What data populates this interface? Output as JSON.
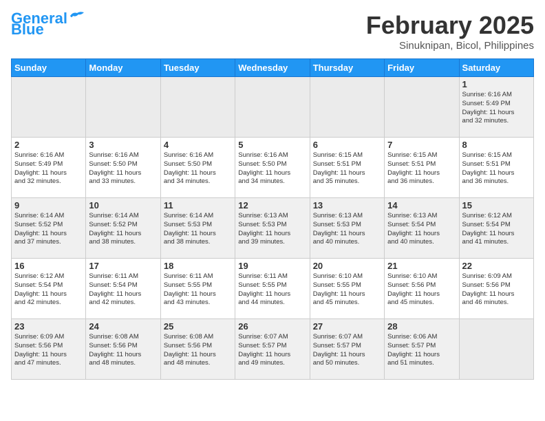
{
  "header": {
    "logo_line1": "General",
    "logo_line2": "Blue",
    "month": "February 2025",
    "location": "Sinuknipan, Bicol, Philippines"
  },
  "days_of_week": [
    "Sunday",
    "Monday",
    "Tuesday",
    "Wednesday",
    "Thursday",
    "Friday",
    "Saturday"
  ],
  "weeks": [
    [
      {
        "day": "",
        "info": ""
      },
      {
        "day": "",
        "info": ""
      },
      {
        "day": "",
        "info": ""
      },
      {
        "day": "",
        "info": ""
      },
      {
        "day": "",
        "info": ""
      },
      {
        "day": "",
        "info": ""
      },
      {
        "day": "1",
        "info": "Sunrise: 6:16 AM\nSunset: 5:49 PM\nDaylight: 11 hours\nand 32 minutes."
      }
    ],
    [
      {
        "day": "2",
        "info": "Sunrise: 6:16 AM\nSunset: 5:49 PM\nDaylight: 11 hours\nand 32 minutes."
      },
      {
        "day": "3",
        "info": "Sunrise: 6:16 AM\nSunset: 5:50 PM\nDaylight: 11 hours\nand 33 minutes."
      },
      {
        "day": "4",
        "info": "Sunrise: 6:16 AM\nSunset: 5:50 PM\nDaylight: 11 hours\nand 34 minutes."
      },
      {
        "day": "5",
        "info": "Sunrise: 6:16 AM\nSunset: 5:50 PM\nDaylight: 11 hours\nand 34 minutes."
      },
      {
        "day": "6",
        "info": "Sunrise: 6:15 AM\nSunset: 5:51 PM\nDaylight: 11 hours\nand 35 minutes."
      },
      {
        "day": "7",
        "info": "Sunrise: 6:15 AM\nSunset: 5:51 PM\nDaylight: 11 hours\nand 36 minutes."
      },
      {
        "day": "8",
        "info": "Sunrise: 6:15 AM\nSunset: 5:51 PM\nDaylight: 11 hours\nand 36 minutes."
      }
    ],
    [
      {
        "day": "9",
        "info": "Sunrise: 6:14 AM\nSunset: 5:52 PM\nDaylight: 11 hours\nand 37 minutes."
      },
      {
        "day": "10",
        "info": "Sunrise: 6:14 AM\nSunset: 5:52 PM\nDaylight: 11 hours\nand 38 minutes."
      },
      {
        "day": "11",
        "info": "Sunrise: 6:14 AM\nSunset: 5:53 PM\nDaylight: 11 hours\nand 38 minutes."
      },
      {
        "day": "12",
        "info": "Sunrise: 6:13 AM\nSunset: 5:53 PM\nDaylight: 11 hours\nand 39 minutes."
      },
      {
        "day": "13",
        "info": "Sunrise: 6:13 AM\nSunset: 5:53 PM\nDaylight: 11 hours\nand 40 minutes."
      },
      {
        "day": "14",
        "info": "Sunrise: 6:13 AM\nSunset: 5:54 PM\nDaylight: 11 hours\nand 40 minutes."
      },
      {
        "day": "15",
        "info": "Sunrise: 6:12 AM\nSunset: 5:54 PM\nDaylight: 11 hours\nand 41 minutes."
      }
    ],
    [
      {
        "day": "16",
        "info": "Sunrise: 6:12 AM\nSunset: 5:54 PM\nDaylight: 11 hours\nand 42 minutes."
      },
      {
        "day": "17",
        "info": "Sunrise: 6:11 AM\nSunset: 5:54 PM\nDaylight: 11 hours\nand 42 minutes."
      },
      {
        "day": "18",
        "info": "Sunrise: 6:11 AM\nSunset: 5:55 PM\nDaylight: 11 hours\nand 43 minutes."
      },
      {
        "day": "19",
        "info": "Sunrise: 6:11 AM\nSunset: 5:55 PM\nDaylight: 11 hours\nand 44 minutes."
      },
      {
        "day": "20",
        "info": "Sunrise: 6:10 AM\nSunset: 5:55 PM\nDaylight: 11 hours\nand 45 minutes."
      },
      {
        "day": "21",
        "info": "Sunrise: 6:10 AM\nSunset: 5:56 PM\nDaylight: 11 hours\nand 45 minutes."
      },
      {
        "day": "22",
        "info": "Sunrise: 6:09 AM\nSunset: 5:56 PM\nDaylight: 11 hours\nand 46 minutes."
      }
    ],
    [
      {
        "day": "23",
        "info": "Sunrise: 6:09 AM\nSunset: 5:56 PM\nDaylight: 11 hours\nand 47 minutes."
      },
      {
        "day": "24",
        "info": "Sunrise: 6:08 AM\nSunset: 5:56 PM\nDaylight: 11 hours\nand 48 minutes."
      },
      {
        "day": "25",
        "info": "Sunrise: 6:08 AM\nSunset: 5:56 PM\nDaylight: 11 hours\nand 48 minutes."
      },
      {
        "day": "26",
        "info": "Sunrise: 6:07 AM\nSunset: 5:57 PM\nDaylight: 11 hours\nand 49 minutes."
      },
      {
        "day": "27",
        "info": "Sunrise: 6:07 AM\nSunset: 5:57 PM\nDaylight: 11 hours\nand 50 minutes."
      },
      {
        "day": "28",
        "info": "Sunrise: 6:06 AM\nSunset: 5:57 PM\nDaylight: 11 hours\nand 51 minutes."
      },
      {
        "day": "",
        "info": ""
      }
    ]
  ]
}
